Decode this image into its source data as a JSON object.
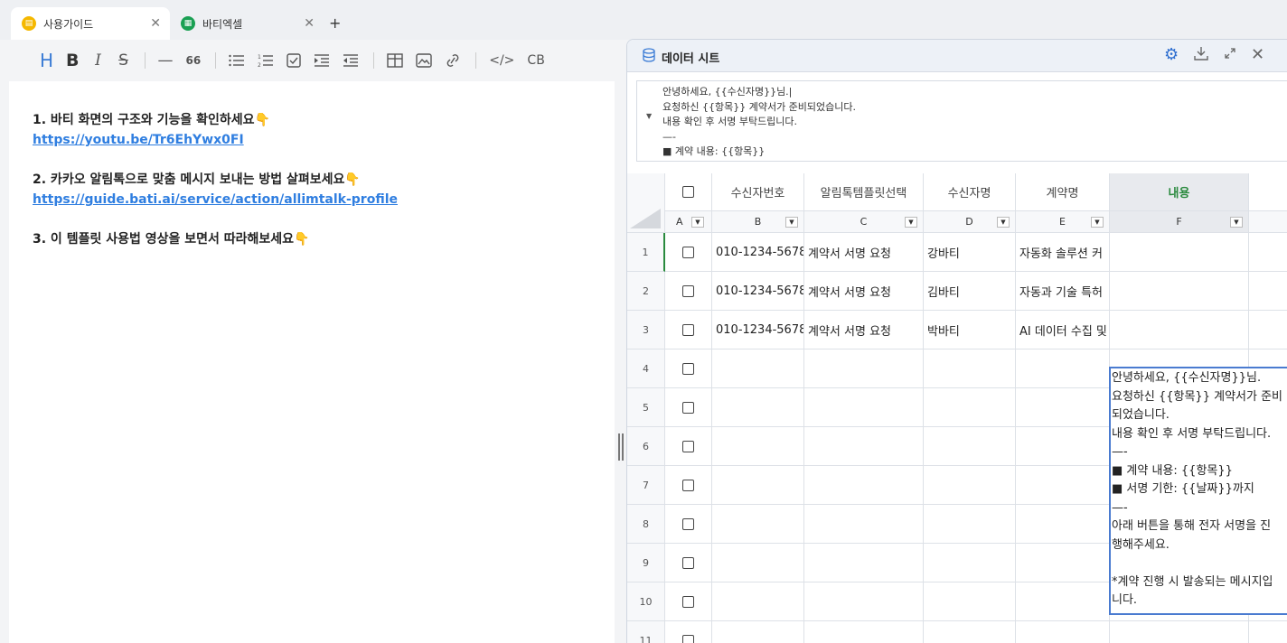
{
  "tabs": [
    {
      "label": "사용가이드",
      "icon": "guide-icon",
      "color": "#f5b800"
    },
    {
      "label": "바티엑셀",
      "icon": "spreadsheet-icon",
      "color": "#1aa053"
    }
  ],
  "new_tab": "+",
  "toolbar": {
    "heading": "H",
    "bold": "B",
    "italic": "I",
    "strike": "S",
    "hr": "—",
    "quote": "66",
    "code": "</>",
    "codeblock": "CB"
  },
  "content": {
    "p1": "1. 바티 화면의 구조와 기능을 확인하세요👇",
    "link1": "https://youtu.be/Tr6EhYwx0FI",
    "p2": "2. 카카오 알림톡으로 맞춤 메시지 보내는 방법 살펴보세요👇",
    "link2": "https://guide.bati.ai/service/action/allimtalk-profile",
    "p3": "3. 이 템플릿 사용법 영상을 보면서 따라해보세요👇"
  },
  "panel": {
    "title": "데이터 시트",
    "formula_text": "안녕하세요, {{수신자명}}님.|\n요청하신 {{항목}} 계약서가 준비되었습니다.\n내용 확인 후 서명 부탁드립니다.\n—-\n■ 계약 내용: {{항목}}"
  },
  "sheet": {
    "headers": [
      "수신자번호",
      "알림톡템플릿선택",
      "수신자명",
      "계약명",
      "내용"
    ],
    "col_letters": [
      "A",
      "B",
      "C",
      "D",
      "E",
      "F"
    ],
    "rows": [
      {
        "n": "1",
        "phone": "010-1234-5678",
        "template": "계약서 서명 요청",
        "name": "강바티",
        "contract": "자동화 솔루션 커"
      },
      {
        "n": "2",
        "phone": "010-1234-5678",
        "template": "계약서 서명 요청",
        "name": "김바티",
        "contract": "자동과 기술 특허"
      },
      {
        "n": "3",
        "phone": "010-1234-5678",
        "template": "계약서 서명 요청",
        "name": "박바티",
        "contract": "AI 데이터 수집 및"
      },
      {
        "n": "4",
        "phone": "",
        "template": "",
        "name": "",
        "contract": ""
      },
      {
        "n": "5",
        "phone": "",
        "template": "",
        "name": "",
        "contract": ""
      },
      {
        "n": "6",
        "phone": "",
        "template": "",
        "name": "",
        "contract": ""
      },
      {
        "n": "7",
        "phone": "",
        "template": "",
        "name": "",
        "contract": ""
      },
      {
        "n": "8",
        "phone": "",
        "template": "",
        "name": "",
        "contract": ""
      },
      {
        "n": "9",
        "phone": "",
        "template": "",
        "name": "",
        "contract": ""
      },
      {
        "n": "10",
        "phone": "",
        "template": "",
        "name": "",
        "contract": ""
      },
      {
        "n": "11",
        "phone": "",
        "template": "",
        "name": "",
        "contract": ""
      }
    ],
    "popup_text": "안녕하세요, {{수신자명}}님.\n요청하신 {{항목}} 계약서가 준비\n되었습니다.\n내용 확인 후 서명 부탁드립니다.\n—-\n■ 계약 내용: {{항목}}\n■ 서명 기한: {{날짜}}까지\n—-\n아래 버튼을 통해 전자 서명을 진\n행해주세요.\n\n*계약 진행 시 발송되는 메시지입\n니다."
  },
  "colors": {
    "accent": "#3a7bd5",
    "selected_header": "#2a8a3e",
    "popup_border": "#4a7bd0"
  }
}
